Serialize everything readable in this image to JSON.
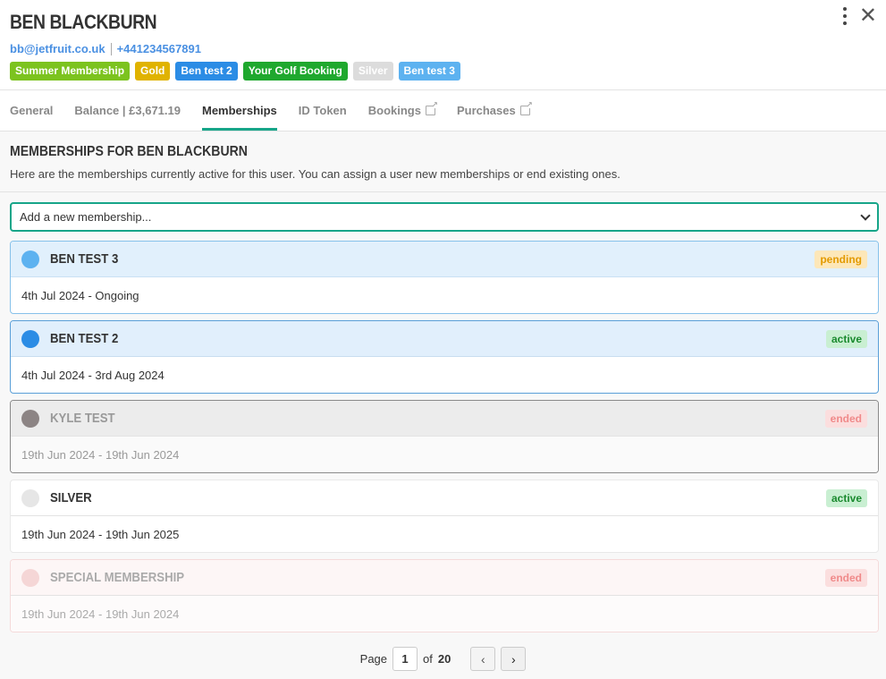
{
  "user": {
    "name": "BEN BLACKBURN",
    "email": "bb@jetfruit.co.uk",
    "phone": "+441234567891"
  },
  "tags": [
    {
      "label": "Summer Membership",
      "color": "#7cc31f"
    },
    {
      "label": "Gold",
      "color": "#e0b300"
    },
    {
      "label": "Ben test 2",
      "color": "#2b8ce5"
    },
    {
      "label": "Your Golf Booking",
      "color": "#1fa82e"
    },
    {
      "label": "Silver",
      "color": "#dcdcdc"
    },
    {
      "label": "Ben test 3",
      "color": "#5db2f0"
    }
  ],
  "header_icons": {
    "menu": "kebab-menu-icon",
    "close": "close-icon"
  },
  "tabs": [
    {
      "label": "General"
    },
    {
      "label": "Balance | £3,671.19"
    },
    {
      "label": "Memberships",
      "active": true
    },
    {
      "label": "ID Token"
    },
    {
      "label": "Bookings",
      "external": true
    },
    {
      "label": "Purchases",
      "external": true
    }
  ],
  "section": {
    "title": "MEMBERSHIPS FOR BEN BLACKBURN",
    "description": "Here are the memberships currently active for this user. You can assign a user new memberships or end existing ones."
  },
  "add_select": {
    "placeholder": "Add a new membership..."
  },
  "memberships": [
    {
      "name": "BEN TEST 3",
      "dates": "4th Jul 2024 - Ongoing",
      "status": "pending",
      "dot_color": "#5db2f0",
      "status_bg": "#fde7b8",
      "status_color": "#e39a00"
    },
    {
      "name": "BEN TEST 2",
      "dates": "4th Jul 2024 - 3rd Aug 2024",
      "status": "active",
      "dot_color": "#2b8ce5",
      "status_bg": "#c9efd2",
      "status_color": "#1a8a2e"
    },
    {
      "name": "KYLE TEST",
      "dates": "19th Jun 2024 - 19th Jun 2024",
      "status": "ended",
      "dot_color": "#8c8484",
      "status_bg": "#fbdede",
      "status_color": "#f08a8a"
    },
    {
      "name": "SILVER",
      "dates": "19th Jun 2024 - 19th Jun 2025",
      "status": "active",
      "dot_color": "#e6e6e6",
      "status_bg": "#c9efd2",
      "status_color": "#1a8a2e"
    },
    {
      "name": "SPECIAL MEMBERSHIP",
      "dates": "19th Jun 2024 - 19th Jun 2024",
      "status": "ended",
      "dot_color": "#f5d6d6",
      "status_bg": "#fbdede",
      "status_color": "#f08a8a"
    }
  ],
  "pagination": {
    "label": "Page",
    "current": "1",
    "of_label": "of",
    "total": "20",
    "prev_icon": "chevron-left-icon",
    "next_icon": "chevron-right-icon"
  }
}
